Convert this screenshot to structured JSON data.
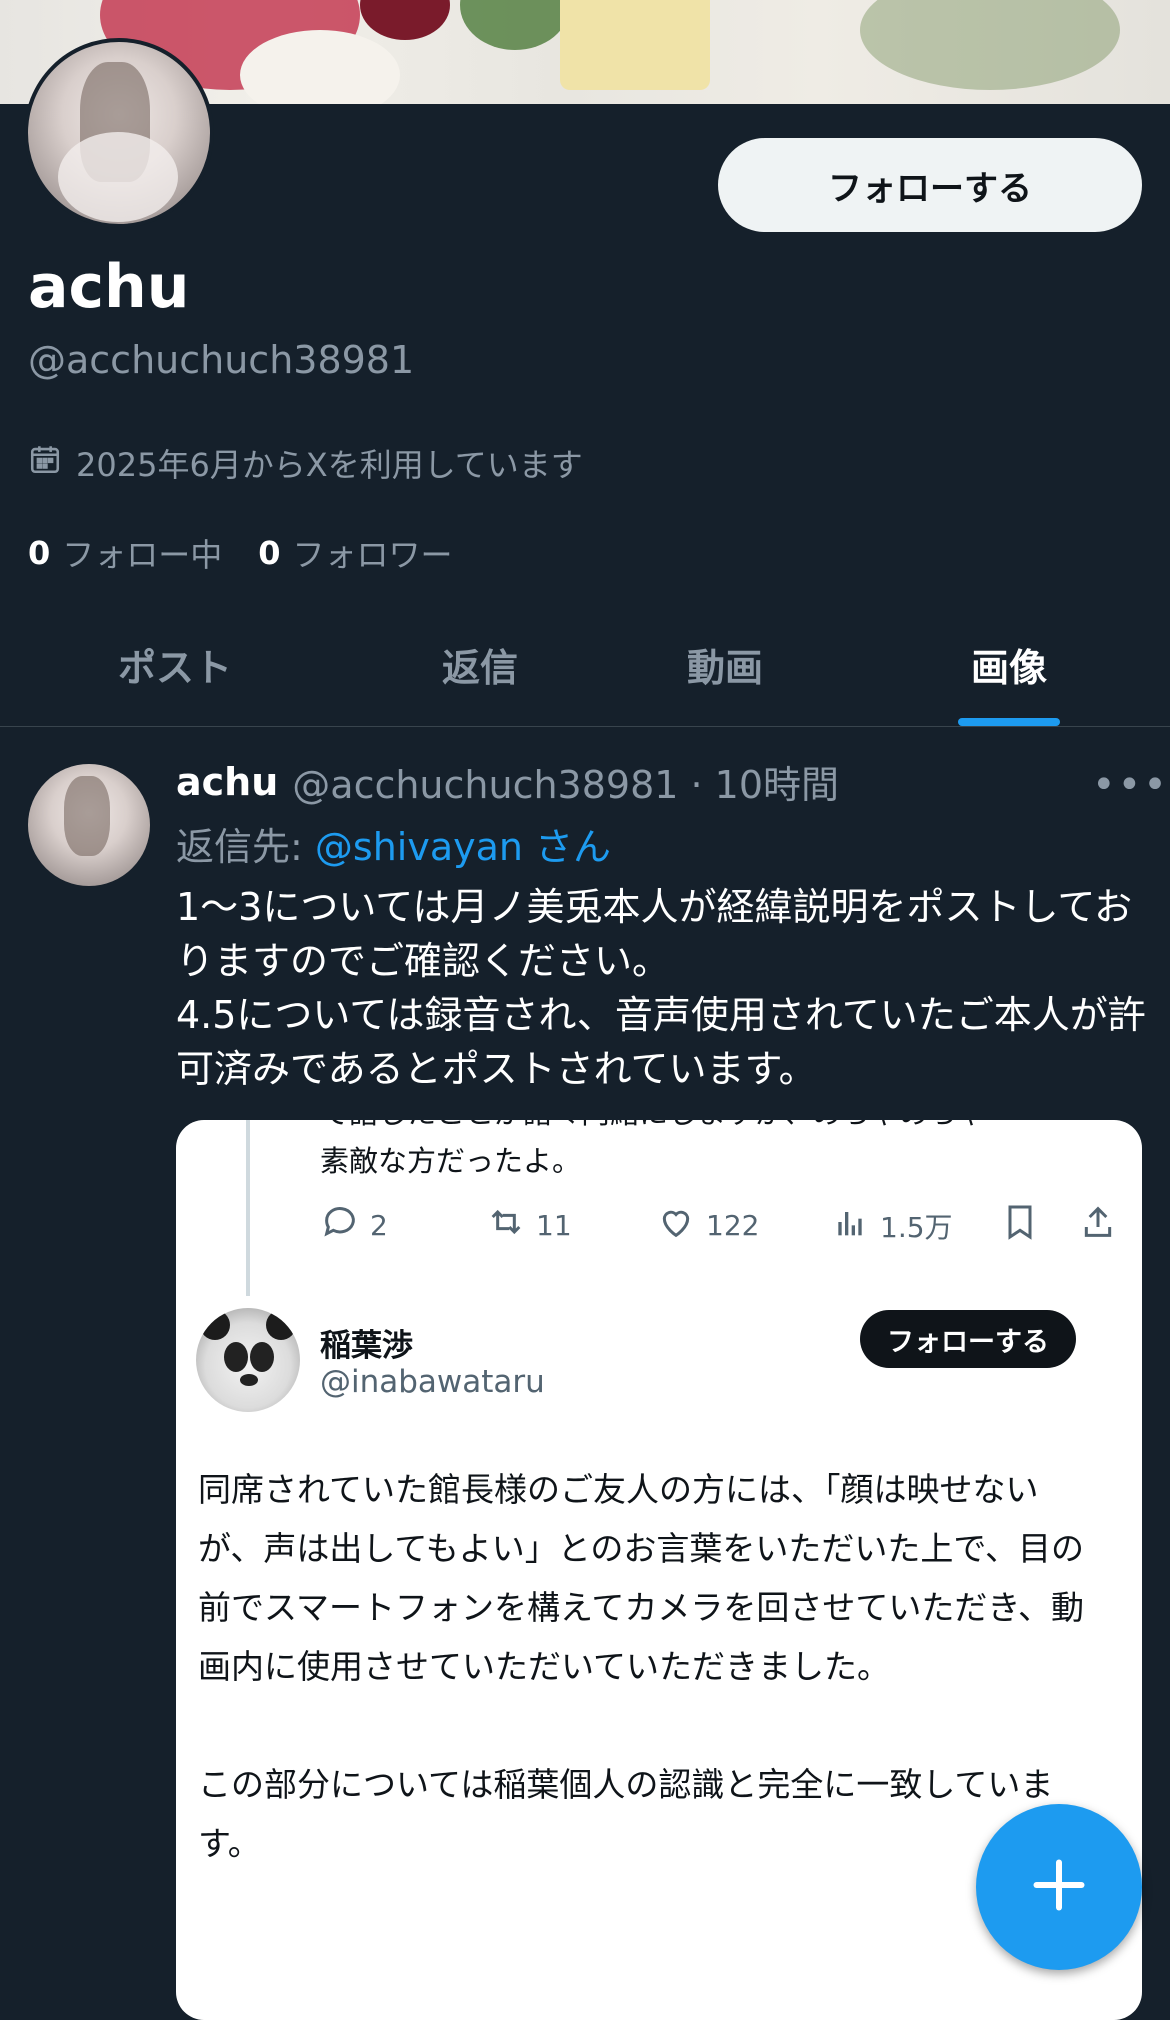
{
  "profile": {
    "follow_label": "フォローする",
    "display_name": "achu",
    "handle": "@acchuchuch38981",
    "joined": "2025年6月からXを利用しています",
    "following_count": "0",
    "following_label": "フォロー中",
    "followers_count": "0",
    "followers_label": "フォロワー"
  },
  "tabs": [
    {
      "label": "ポスト"
    },
    {
      "label": "返信"
    },
    {
      "label": "動画"
    },
    {
      "label": "画像",
      "active": true
    }
  ],
  "post": {
    "name": "achu",
    "handle_time": "@acchuchuch38981 · 10時間",
    "reply_prefix": "返信先: ",
    "reply_mention": "@shivayan さん",
    "text": "1〜3については月ノ美兎本人が経緯説明をポストしておりますのでご確認ください。\n4.5については録音され、音声使用されていたご本人が許可済みであるとポストされています。",
    "more_icon": "more-icon"
  },
  "embed": {
    "cut_line": "で話したことが諸々内緒にしますが、めちゃめちゃ",
    "top_line": "素敵な方だったよ。",
    "replies": "2",
    "reposts": "11",
    "likes": "122",
    "views": "1.5万",
    "author_name": "稲葉渉",
    "author_handle": "@inabawataru",
    "follow_label": "フォローする",
    "text": "同席されていた館長様のご友人の方には、「顔は映せないが、声は出してもよい」とのお言葉をいただいた上で、目の前でスマートフォンを構えてカメラを回させていただき、動画内に使用させていただいていただきました。\n\nこの部分については稲葉個人の認識と完全に一致しています。"
  },
  "colors": {
    "background": "#15202b",
    "accent": "#1d9bf0",
    "muted": "#8b98a5"
  }
}
